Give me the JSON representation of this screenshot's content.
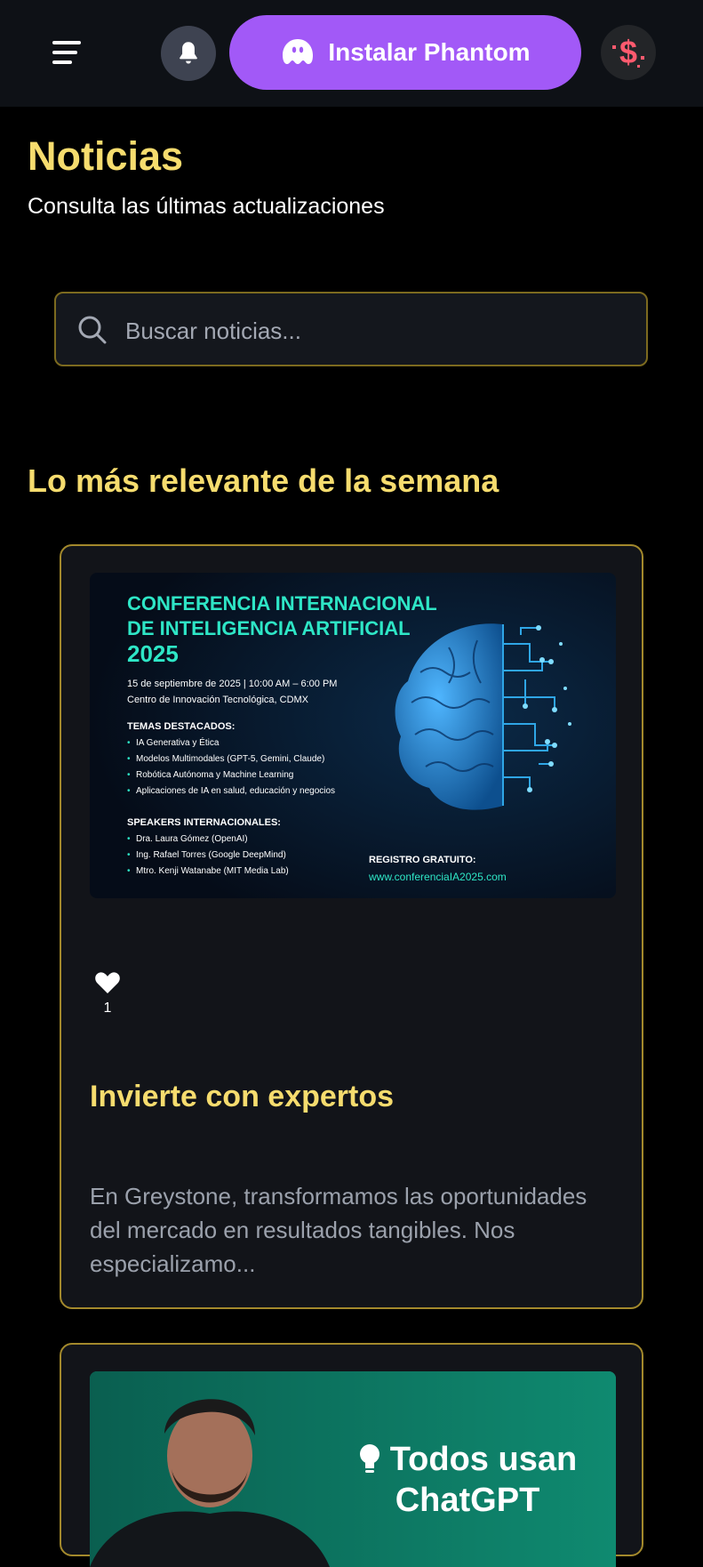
{
  "header": {
    "install_label": "Instalar Phantom",
    "icons": [
      "menu-icon",
      "bell-icon",
      "phantom-ghost-icon",
      "dollar-icon"
    ]
  },
  "page": {
    "title": "Noticias",
    "subtitle": "Consulta las últimas actualizaciones"
  },
  "search": {
    "placeholder": "Buscar noticias..."
  },
  "section": {
    "title": "Lo más relevante de la semana"
  },
  "cards": [
    {
      "image": {
        "heading_line1": "CONFERENCIA INTERNACIONAL",
        "heading_line2": "DE INTELIGENCIA ARTIFICIAL",
        "heading_line3": "2025",
        "date_line": "15 de septiembre de 2025 | 10:00 AM – 6:00 PM",
        "place_line": "Centro de Innovación Tecnológica, CDMX",
        "topics_title": "TEMAS DESTACADOS:",
        "topics": [
          "IA Generativa y Ética",
          "Modelos Multimodales (GPT-5, Gemini, Claude)",
          "Robótica Autónoma y Machine Learning",
          "Aplicaciones de IA en salud, educación y negocios"
        ],
        "speakers_title": "SPEAKERS INTERNACIONALES:",
        "speakers": [
          "Dra. Laura Gómez (OpenAI)",
          "Ing. Rafael Torres (Google DeepMind)",
          "Mtro. Kenji Watanabe (MIT Media Lab)"
        ],
        "registro_label": "REGISTRO GRATUITO:",
        "registro_url": "www.conferenciaIA2025.com"
      },
      "likes": "1",
      "title": "Invierte con expertos",
      "excerpt": "En Greystone, transformamos las oportunidades del mercado en resultados tangibles. Nos especializamo..."
    },
    {
      "promo_line1": "Todos usan",
      "promo_line2": "ChatGPT"
    }
  ],
  "colors": {
    "accent_yellow": "#f6dc6e",
    "phantom_purple": "#a259f7",
    "card_border": "#a3892c",
    "neon_cyan": "#2ee6c6"
  }
}
